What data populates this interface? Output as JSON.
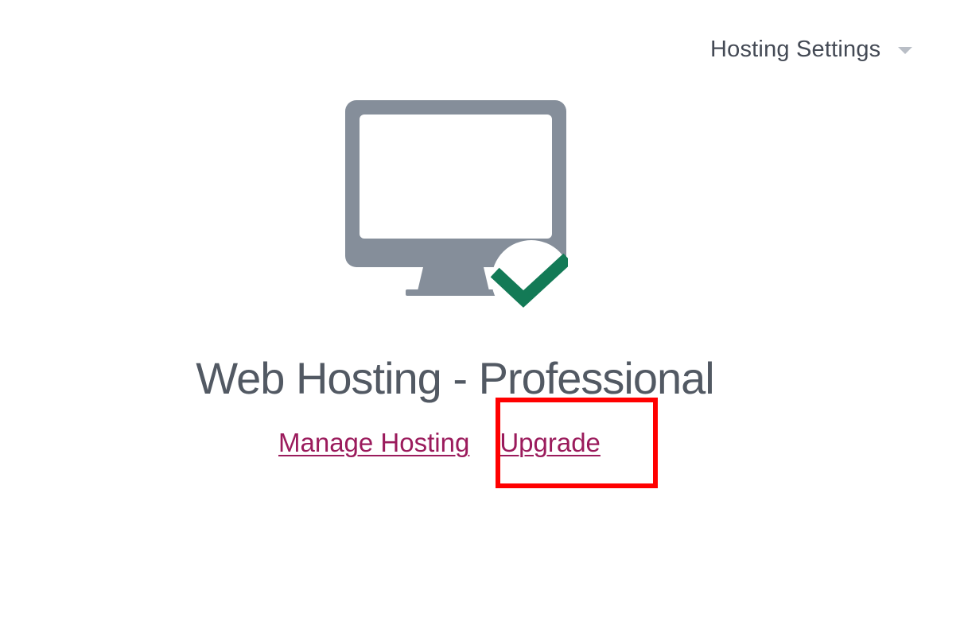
{
  "header": {
    "settings_dropdown_label": "Hosting Settings"
  },
  "product": {
    "icon": "monitor-check-icon",
    "title": "Web Hosting - Professional"
  },
  "actions": {
    "manage_label": "Manage Hosting",
    "upgrade_label": "Upgrade"
  },
  "colors": {
    "link": "#9b1b5c",
    "icon_gray": "#858e9a",
    "check_green": "#137a56",
    "highlight": "#ff0000"
  }
}
